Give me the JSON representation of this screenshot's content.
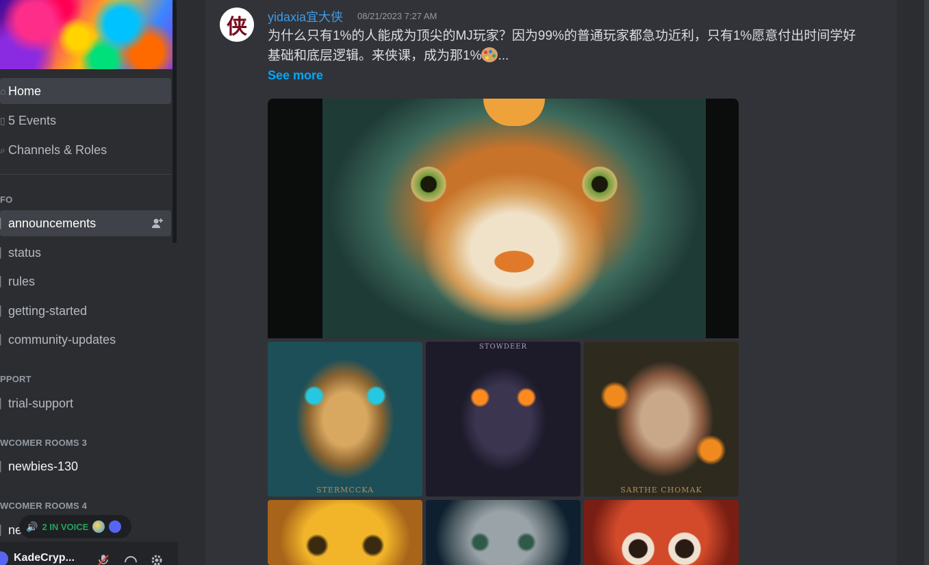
{
  "sidebar": {
    "items": [
      {
        "label": "Home"
      },
      {
        "label": "5 Events"
      },
      {
        "label": "Channels & Roles"
      }
    ],
    "categories": [
      {
        "label": "FO"
      },
      {
        "label": "PPORT"
      },
      {
        "label": "WCOMER ROOMS 3"
      },
      {
        "label": "WCOMER ROOMS 4"
      }
    ],
    "channels": [
      {
        "label": "announcements"
      },
      {
        "label": "status"
      },
      {
        "label": "rules"
      },
      {
        "label": "getting-started"
      },
      {
        "label": "community-updates"
      },
      {
        "label": "trial-support"
      },
      {
        "label": "newbies-130"
      },
      {
        "label": "ne"
      }
    ],
    "voice": {
      "label": "2 IN VOICE"
    },
    "user": {
      "name": "KadeCryp..."
    }
  },
  "message": {
    "author": "yidaxia宜大侠",
    "avatar_char": "侠",
    "timestamp": "08/21/2023 7:27 AM",
    "line1": "为什么只有1%的人能成为顶尖的MJ玩家？因为99%的普通玩家都急功近利，只有1%愿意付出时间学好",
    "line2": "基础和底层逻辑。来侠课，成为那1%",
    "line2_tail": "...",
    "see_more": "See more"
  },
  "images": {
    "t1_caption": "STERMCCKA",
    "t2_caption": "STOWDEER",
    "t3_caption": "SARTHE CHOMAK"
  }
}
